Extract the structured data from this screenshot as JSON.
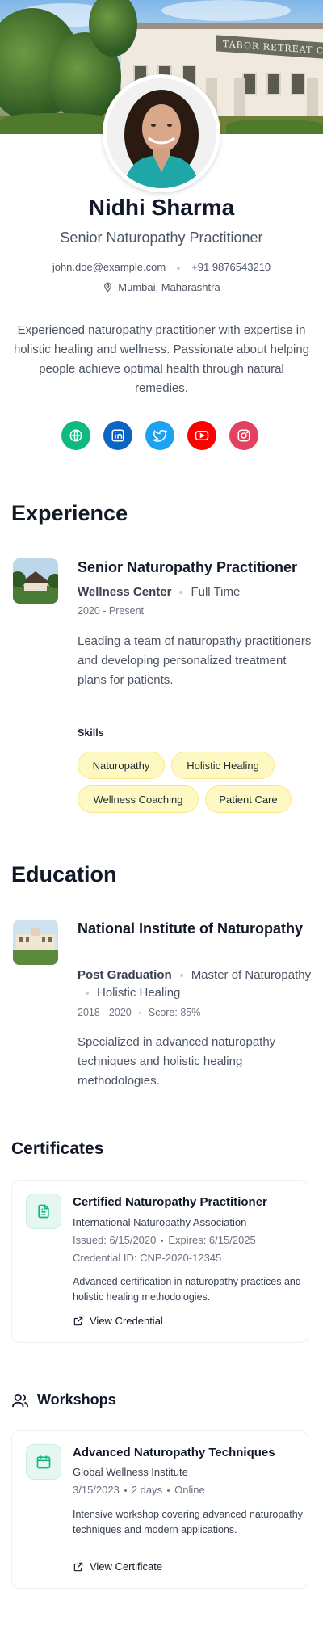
{
  "cover": {
    "sign_text": "TABOR RETREAT CENTER"
  },
  "profile": {
    "name": "Nidhi Sharma",
    "title": "Senior Naturopathy Practitioner",
    "email": "john.doe@example.com",
    "phone": "+91 9876543210",
    "location": "Mumbai, Maharashtra",
    "bio": "Experienced naturopathy practitioner with expertise in holistic healing and wellness. Passionate about helping people achieve optimal health through natural remedies."
  },
  "socials": [
    {
      "icon": "globe-icon",
      "color": "#10b981"
    },
    {
      "icon": "linkedin-icon",
      "color": "#0a66c2"
    },
    {
      "icon": "twitter-icon",
      "color": "#1da1f2"
    },
    {
      "icon": "youtube-icon",
      "color": "#ff0000"
    },
    {
      "icon": "instagram-icon",
      "color": "#e4405f"
    }
  ],
  "experience": {
    "heading": "Experience",
    "title": "Senior Naturopathy Practitioner",
    "company": "Wellness Center",
    "type": "Full Time",
    "period": "2020 - Present",
    "description": "Leading a team of naturopathy practitioners and developing personalized treatment plans for patients.",
    "skills_label": "Skills",
    "skills": [
      "Naturopathy",
      "Holistic Healing",
      "Wellness Coaching",
      "Patient Care"
    ]
  },
  "education": {
    "heading": "Education",
    "school": "National Institute of Naturopathy",
    "level": "Post Graduation",
    "degree": "Master of Naturopathy",
    "field": "Holistic Healing",
    "period": "2018 - 2020",
    "score": "Score: 85%",
    "description": "Specialized in advanced naturopathy techniques and holistic healing methodologies."
  },
  "certificates": {
    "heading": "Certificates",
    "items": [
      {
        "title": "Certified Naturopathy Practitioner",
        "issuer": "International Naturopathy Association",
        "issued": "Issued: 6/15/2020",
        "expires": "Expires: 6/15/2025",
        "credential": "Credential ID: CNP-2020-12345",
        "description": "Advanced certification in naturopathy practices and holistic healing methodologies.",
        "link_label": "View Credential"
      }
    ]
  },
  "workshops": {
    "heading": "Workshops",
    "items": [
      {
        "title": "Advanced Naturopathy Techniques",
        "organizer": "Global Wellness Institute",
        "date": "3/15/2023",
        "duration": "2 days",
        "mode": "Online",
        "description": "Intensive workshop covering advanced naturopathy techniques and modern applications.",
        "link_label": "View Certificate"
      }
    ]
  },
  "colors": {
    "accent": "#10b981",
    "chip_bg": "#fef9c3",
    "chip_border": "#fde68a",
    "text_dark": "#111827",
    "text_muted": "#4b5563"
  }
}
